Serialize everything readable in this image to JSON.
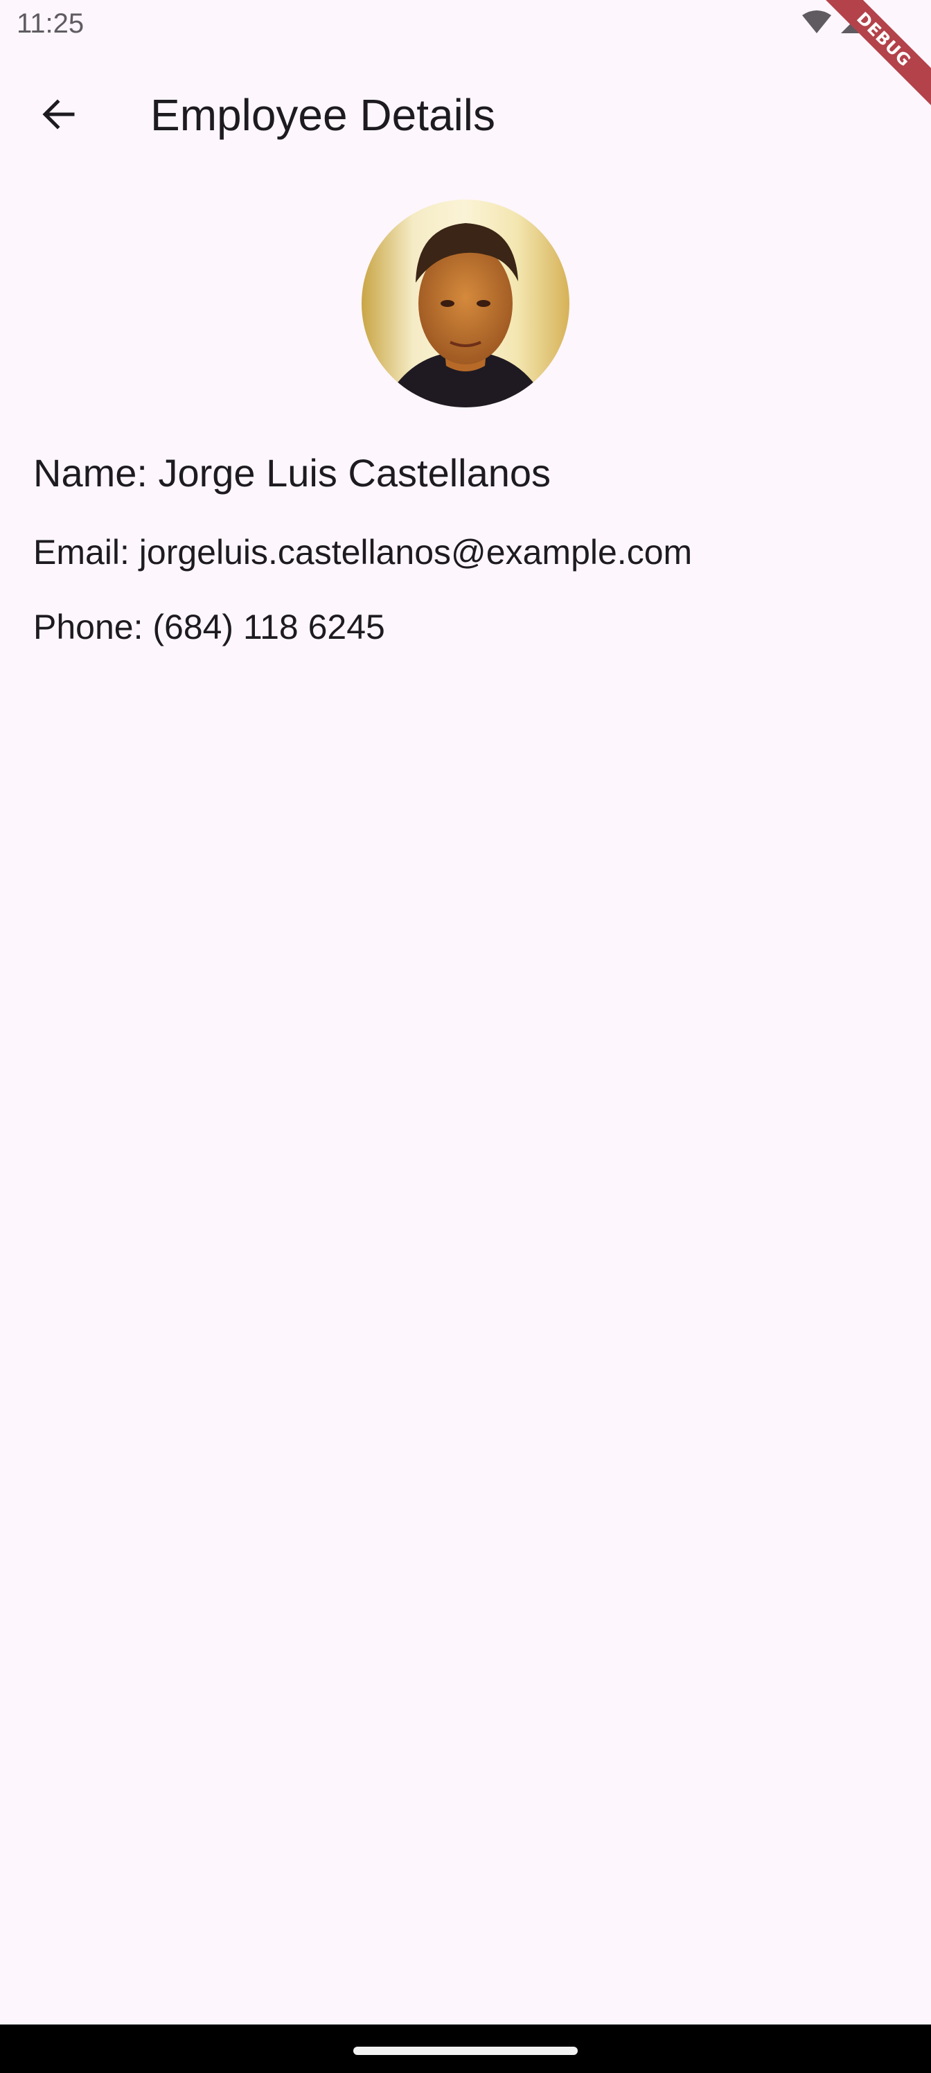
{
  "status_bar": {
    "time": "11:25",
    "icons": [
      "wifi-icon",
      "cell-signal-icon"
    ]
  },
  "debug_banner": {
    "label": "DEBUG",
    "color": "#b3424a"
  },
  "app_bar": {
    "back_icon": "arrow-back-icon",
    "title": "Employee Details"
  },
  "employee": {
    "name": "Name: Jorge Luis Castellanos",
    "email": "Email: jorgeluis.castellanos@example.com",
    "phone": "Phone: (684) 118 6245"
  },
  "colors": {
    "background": "#fdf6fd",
    "text": "#1d1b20"
  }
}
